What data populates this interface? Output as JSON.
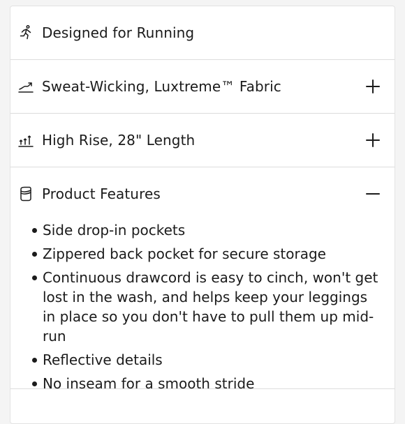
{
  "accordion": {
    "rows": [
      {
        "label": "Designed for Running",
        "icon": "running-person-icon",
        "toggle": null
      },
      {
        "label": "Sweat-Wicking, Luxtreme™ Fabric",
        "icon": "sweat-wicking-icon",
        "toggle": "plus-icon"
      },
      {
        "label": "High Rise, 28\" Length",
        "icon": "rise-length-icon",
        "toggle": "plus-icon"
      }
    ],
    "features": {
      "label": "Product Features",
      "icon": "pocket-icon",
      "toggle": "minus-icon",
      "items": [
        "Side drop-in pockets",
        "Zippered back pocket for secure storage",
        "Continuous drawcord is easy to cinch, won't get lost in the wash, and helps keep your leggings in place so you don't have to pull them up mid-run",
        "Reflective details",
        "No inseam for a smooth stride"
      ]
    }
  },
  "colors": {
    "text": "#1b1b1b",
    "divider": "#dcdcdc",
    "card": "#ffffff"
  }
}
